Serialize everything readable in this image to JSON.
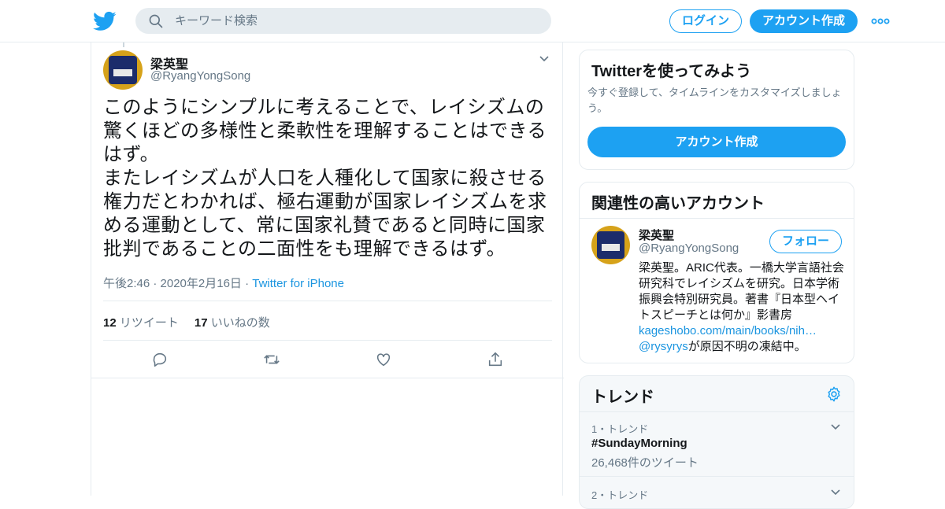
{
  "header": {
    "logo_icon": "twitter-bird-icon",
    "search_placeholder": "キーワード検索",
    "login_label": "ログイン",
    "signup_label": "アカウント作成",
    "more_icon": "more-dots-icon",
    "accent_color": "#1da1f2"
  },
  "tweet": {
    "author_name": "梁英聖",
    "author_handle": "@RyangYongSong",
    "text": "このようにシンプルに考えることで、レイシズムの驚くほどの多様性と柔軟性を理解することはできるはず。\nまたレイシズムが人口を人種化して国家に殺させる権力だとわかれば、極右運動が国家レイシズムを求める運動として、常に国家礼賛であると同時に国家批判であることの二面性をも理解できるはず。",
    "timestamp": "午後2:46 · 2020年2月16日 · ",
    "source": "Twitter for iPhone",
    "retweet_count": "12",
    "retweet_label": "リツイート",
    "like_count": "17",
    "like_label": "いいねの数",
    "actions": [
      "reply-icon",
      "retweet-icon",
      "like-icon",
      "share-icon"
    ]
  },
  "signup_card": {
    "title": "Twitterを使ってみよう",
    "description": "今すぐ登録して、タイムラインをカスタマイズしましょう。",
    "button_label": "アカウント作成"
  },
  "related_card": {
    "title": "関連性の高いアカウント",
    "account_name": "梁英聖",
    "account_handle": "@RyangYongSong",
    "follow_label": "フォロー",
    "bio_text": "梁英聖。ARIC代表。一橋大学言語社会研究科でレイシズムを研究。日本学術振興会特別研究員。著書『日本型ヘイトスピーチとは何か』影書房",
    "bio_link": "kageshobo.com/main/books/nih…",
    "bio_mention": "@rysyrys",
    "bio_suffix": "が原因不明の凍結中。"
  },
  "trends_card": {
    "title": "トレンド",
    "settings_icon": "gear-icon",
    "items": [
      {
        "meta": "1・トレンド",
        "name": "#SundayMorning",
        "count": "26,468件のツイート"
      },
      {
        "meta": "2・トレンド",
        "name": "",
        "count": ""
      }
    ]
  }
}
